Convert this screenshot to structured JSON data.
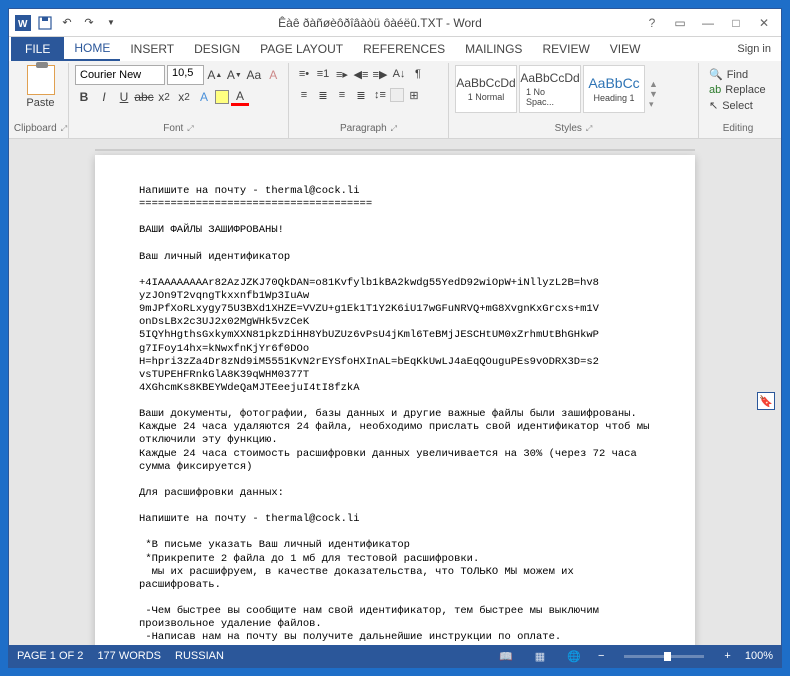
{
  "titlebar": {
    "title": "Êàê ðàñøèôðîâàòü ôàéëû.TXT - Word"
  },
  "menubar": {
    "file": "FILE",
    "tabs": [
      "HOME",
      "INSERT",
      "DESIGN",
      "PAGE LAYOUT",
      "REFERENCES",
      "MAILINGS",
      "REVIEW",
      "VIEW"
    ],
    "active": 0,
    "signin": "Sign in"
  },
  "ribbon": {
    "clipboard": {
      "label": "Clipboard",
      "paste": "Paste"
    },
    "font": {
      "label": "Font",
      "name": "Courier New",
      "size": "10,5"
    },
    "paragraph": {
      "label": "Paragraph"
    },
    "styles": {
      "label": "Styles",
      "items": [
        {
          "preview": "AaBbCcDd",
          "name": "1 Normal"
        },
        {
          "preview": "AaBbCcDd",
          "name": "1 No Spac..."
        },
        {
          "preview": "AaBbCc",
          "name": "Heading 1",
          "heading": true
        }
      ]
    },
    "editing": {
      "label": "Editing",
      "find": "Find",
      "replace": "Replace",
      "select": "Select"
    }
  },
  "document": {
    "text": "Напишите на почту - thermal@cock.li\n=====================================\n\nВАШИ ФАЙЛЫ ЗАШИФРОВАНЫ!\n\nВаш личный идентификатор\n\n+4IAAAAAAAAr82AzJZKJ70QkDAN=o81Kvfylb1kBA2kwdg55YedD92wiOpW+iNllyzL2B=hv8\nyzJOn9T2vqngTkxxnfb1Wp3IuAw\n9mJPfXoRLxygy75U3BXd1XHZE=VVZU+g1Ek1T1Y2K6iU17wGFuNRVQ+mG8XvgnKxGrcxs+m1V\nonDsLBx2c3UJ2x02MgWHk5vzCeK\n5IQYhHgthsGxkymXXN81pkzDiHH8YbUZUz6vPsU4jKml6TeBMjJESCHtUM0xZrhmUtBhGHkwP\ng7IFoy14hx=kNwxfnKjYr6f0DOo\nH=hpri3zZa4Dr8zNd9iM5551KvN2rEYSfoHXInAL=bEqKkUwLJ4aEqQOuguPEs9vODRX3D=s2\nvsTUPEHFRnkGlA8K39qWHM0377T\n4XGhcmKs8KBEYWdeQaMJTEeejuI4tI8fzkA\n\nВаши документы, фотографии, базы данных и другие важные файлы были зашифрованы.\nКаждые 24 часа удаляются 24 файла, необходимо прислать свой идентификатор чтоб мы отключили эту функцию.\nКаждые 24 часа стоимость расшифровки данных увеличивается на 30% (через 72 часа сумма фиксируется)\n\nДля расшифровки данных:\n\nНапишите на почту - thermal@cock.li\n\n *В письме указать Ваш личный идентификатор\n *Прикрепите 2 файла до 1 мб для тестовой расшифровки.\n  мы их расшифруем, в качестве доказательства, что ТОЛЬКО МЫ можем их расшифровать.\n\n -Чем быстрее вы сообщите нам свой идентификатор, тем быстрее мы выключим произвольное удаление файлов.\n -Написав нам на почту вы получите дальнейшие инструкции по оплате."
  },
  "statusbar": {
    "page": "PAGE 1 OF 2",
    "words": "177 WORDS",
    "lang": "RUSSIAN",
    "zoom": "100%"
  }
}
